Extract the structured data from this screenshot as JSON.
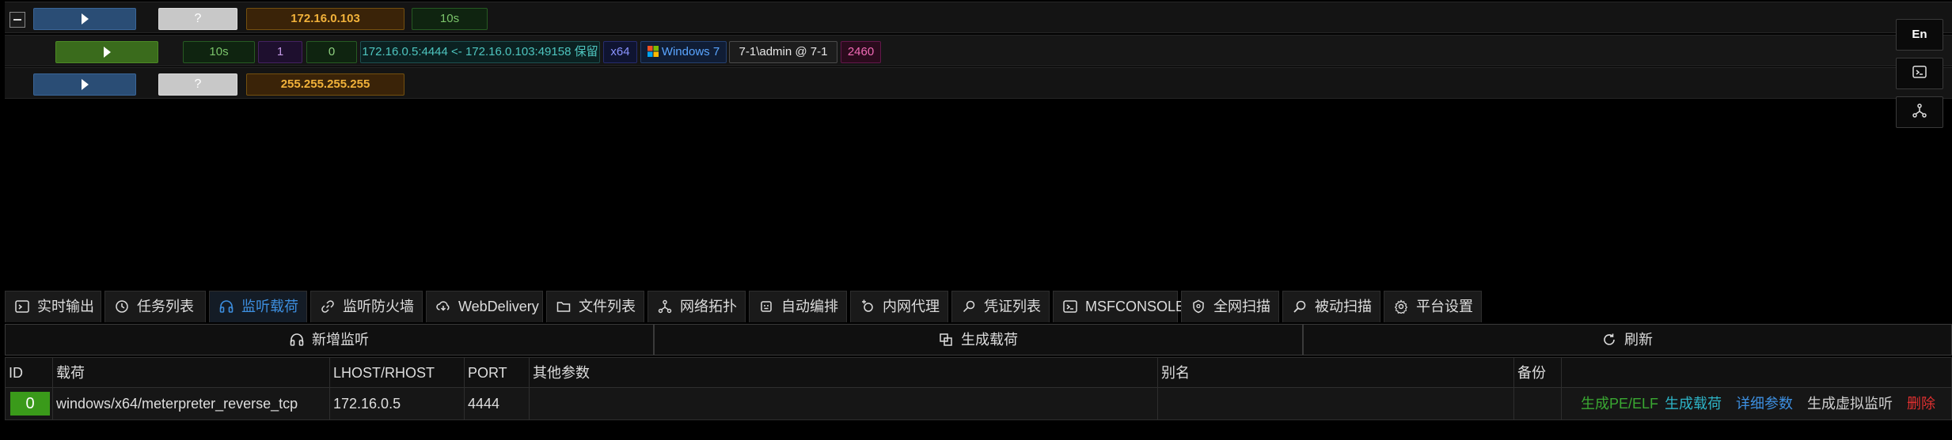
{
  "colors": {
    "accent": "#3d8fe0",
    "ip_text": "#f2b23a",
    "id_badge": "#3a9a1a",
    "delete": "#e03030"
  },
  "hosts": {
    "row1": {
      "ip": "172.16.0.103",
      "heartbeat": "10s",
      "placeholder": "?"
    },
    "row2": {
      "heartbeat": "10s",
      "count_a": "1",
      "count_b": "0",
      "connection": "172.16.0.5:4444 <- 172.16.0.103:49158 保留",
      "arch": "x64",
      "os": "Windows 7",
      "user": "7-1\\admin @ 7-1",
      "pid": "2460"
    },
    "row3": {
      "ip": "255.255.255.255",
      "placeholder": "?"
    }
  },
  "side": {
    "lang": "En",
    "terminal_icon": "terminal-icon",
    "network_icon": "network-icon"
  },
  "tabs": [
    {
      "label": "实时输出",
      "icon": "terminal-icon"
    },
    {
      "label": "任务列表",
      "icon": "clock-icon"
    },
    {
      "label": "监听载荷",
      "icon": "headphones-icon",
      "active": true
    },
    {
      "label": "监听防火墙",
      "icon": "link-icon"
    },
    {
      "label": "WebDelivery",
      "icon": "cloud-download-icon"
    },
    {
      "label": "文件列表",
      "icon": "folder-icon"
    },
    {
      "label": "网络拓扑",
      "icon": "topology-icon"
    },
    {
      "label": "自动编排",
      "icon": "robot-icon"
    },
    {
      "label": "内网代理",
      "icon": "proxy-icon"
    },
    {
      "label": "凭证列表",
      "icon": "key-icon"
    },
    {
      "label": "MSFCONSOLE",
      "icon": "console-icon"
    },
    {
      "label": "全网扫描",
      "icon": "scan-icon"
    },
    {
      "label": "被动扫描",
      "icon": "search-icon"
    },
    {
      "label": "平台设置",
      "icon": "gear-icon"
    }
  ],
  "toolbar": {
    "add_listener": "新增监听",
    "generate_payload": "生成载荷",
    "refresh": "刷新"
  },
  "table": {
    "headers": [
      "ID",
      "载荷",
      "LHOST/RHOST",
      "PORT",
      "其他参数",
      "别名",
      "备份",
      ""
    ],
    "rows": [
      {
        "id": "0",
        "payload": "windows/x64/meterpreter_reverse_tcp",
        "lhost": "172.16.0.5",
        "port": "4444",
        "other": "",
        "alias": "",
        "backup": "",
        "actions": {
          "gen_pe": "生成PE/ELF",
          "gen_payload": "生成载荷",
          "details": "详细参数",
          "gen_virtual": "生成虚拟监听",
          "delete": "删除"
        }
      }
    ]
  }
}
